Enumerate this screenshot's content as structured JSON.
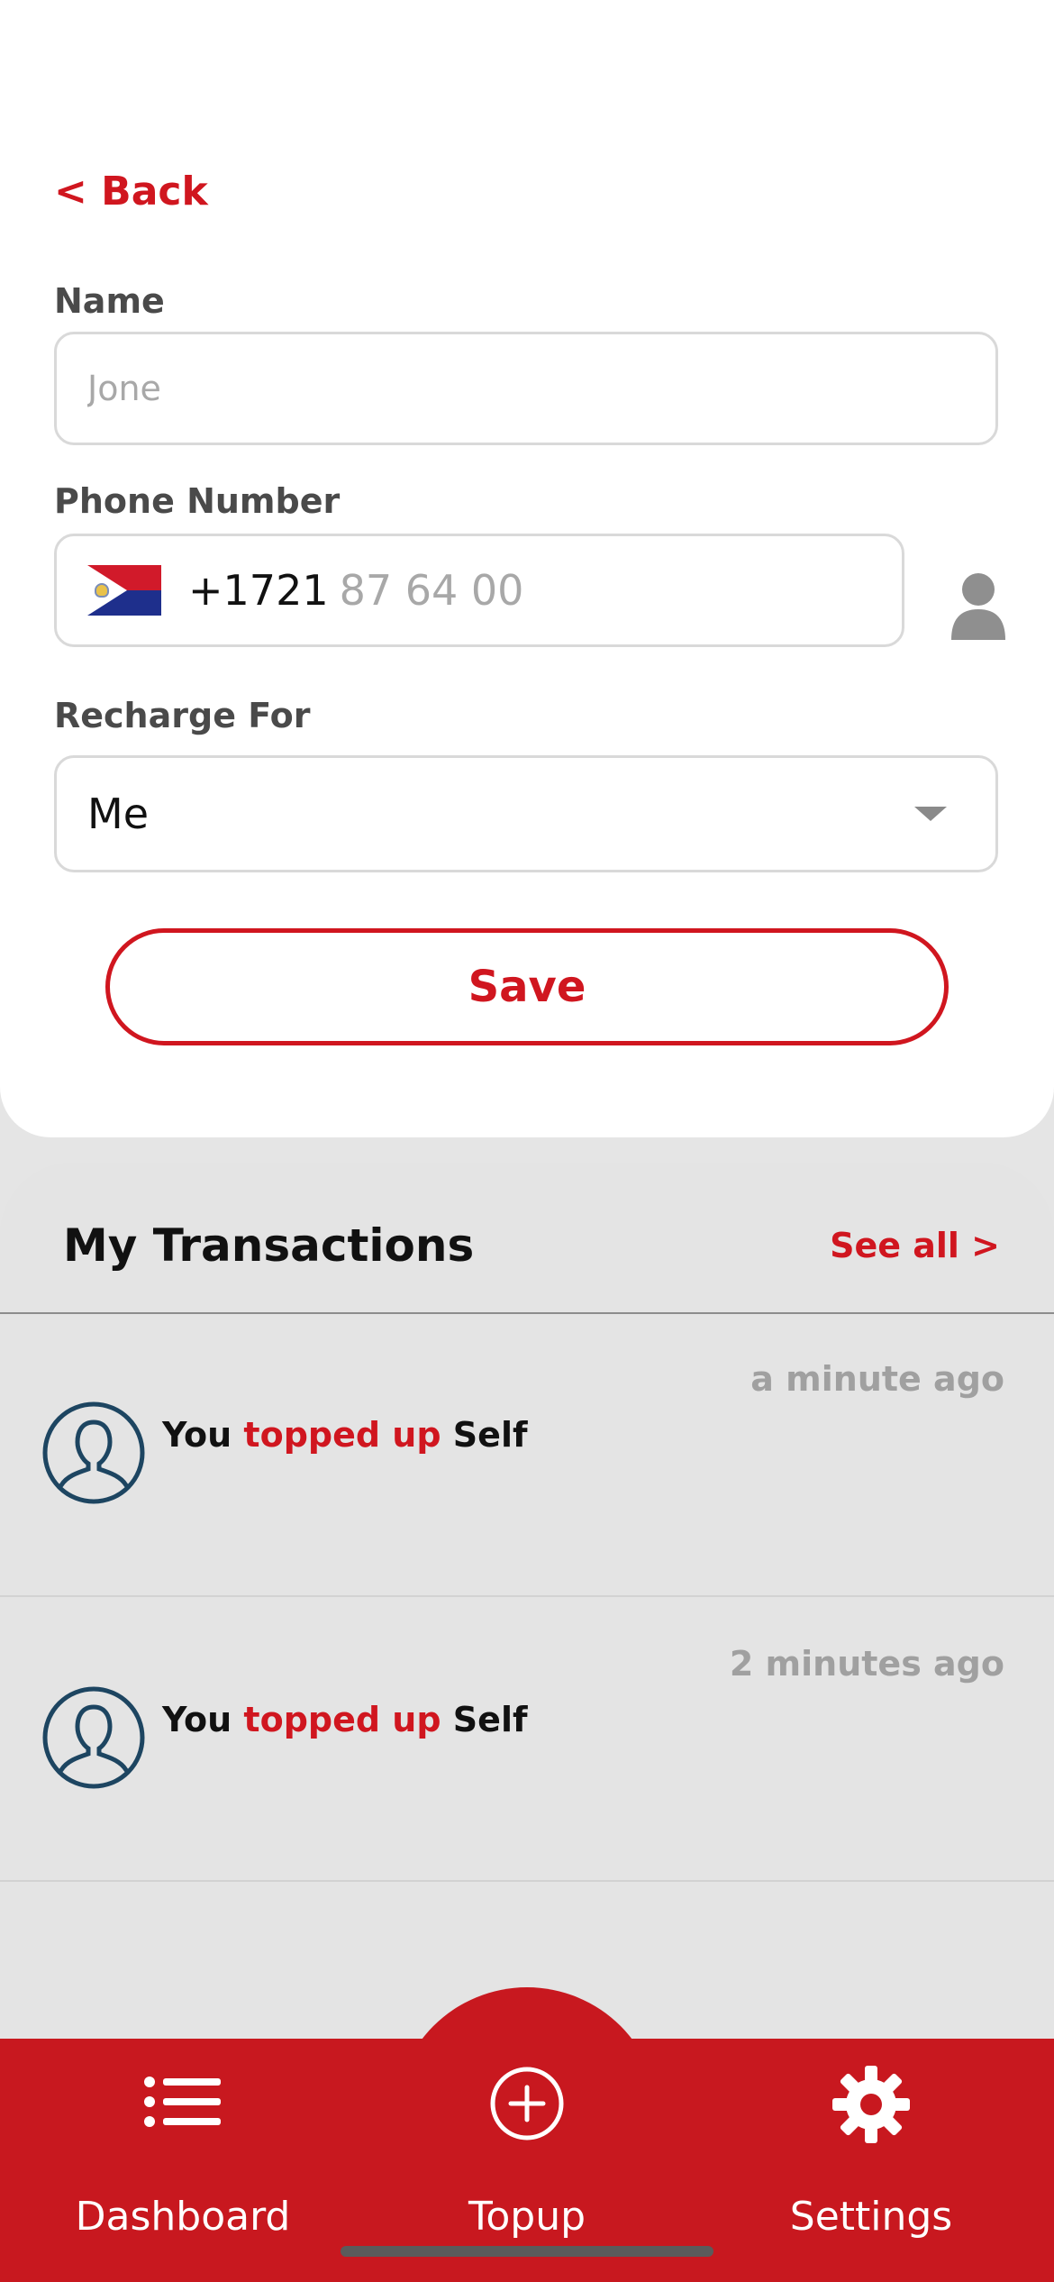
{
  "form": {
    "back_label": "< Back",
    "name_label": "Name",
    "name_placeholder": "Jone",
    "phone_label": "Phone Number",
    "dial_code": "+1721",
    "phone_placeholder": "87 64 00",
    "recharge_label": "Recharge For",
    "recharge_value": "Me",
    "save_label": "Save"
  },
  "transactions": {
    "title": "My Transactions",
    "see_all": "See all >",
    "items": [
      {
        "time": "a minute ago",
        "actor": "You",
        "action": "topped up",
        "target": "Self"
      },
      {
        "time": "2 minutes ago",
        "actor": "You",
        "action": "topped up",
        "target": "Self"
      }
    ]
  },
  "nav": {
    "items": [
      {
        "label": "Dashboard",
        "icon": "list-icon"
      },
      {
        "label": "Topup",
        "icon": "plus-circle-icon"
      },
      {
        "label": "Settings",
        "icon": "gear-icon"
      }
    ]
  },
  "colors": {
    "accent": "#d0161f",
    "nav_background": "#c8181f",
    "avatar_stroke": "#1d4561"
  }
}
